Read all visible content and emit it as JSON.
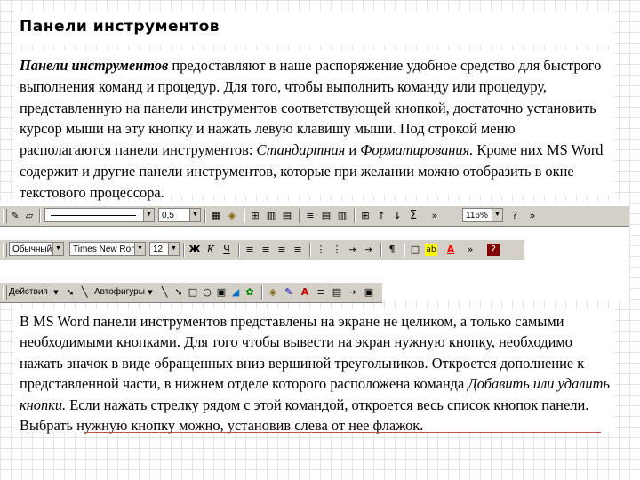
{
  "title": "Панели инструментов",
  "para1": {
    "lead_term": "Панели инструментов",
    "text_a": " предоставляют в наше распоряжение удобное средство для быстрого выполнения команд и процедур. Для того, чтобы выполнить команду или процедуру, представленную на панели инструментов соответствующей кнопкой, достаточно установить курсор мыши на эту кнопку и нажать левую клавишу мыши. Под строкой меню располагаются панели инструментов: ",
    "term_std": "Стандартная",
    "and": " и ",
    "term_fmt": "Форматирования.",
    "text_b": " Кроме них MS Word содержит и другие панели инструментов, которые при желании можно отобразить в окне текстового процессора."
  },
  "toolbars": {
    "standard": {
      "line_weight": "0,5",
      "zoom": "116%"
    },
    "formatting": {
      "style": "Обычный",
      "font": "Times New Roman",
      "size": "12",
      "bold": "Ж",
      "italic": "К",
      "underline": "Ч",
      "paragraph": "¶"
    },
    "drawing": {
      "draw_menu": "Действия",
      "autoshapes": "Автофигуры"
    }
  },
  "para2": {
    "text_a": "В MS Word панели инструментов представлены на экране не целиком, а только самыми необходимыми кнопками. Для того чтобы вывести на экран нужную кнопку, необходимо нажать значок в виде обращенных вниз вершиной треугольников. Откроется дополнение к представленной части, в нижнем отделе которого расположена команда ",
    "term_add": "Добавить или удалить кнопки.",
    "text_b": " Если нажать стрелку рядом с этой командой, откроется весь список кнопок панели. Выбрать нужную кнопку можно, установив слева от нее флажок."
  },
  "icons": {
    "pencil": "✎",
    "eraser": "▱",
    "borders": "▦",
    "fill": "◈",
    "table": "⊞",
    "insert-table": "▥",
    "columns": "▤",
    "sort-asc": "↑",
    "sort-desc": "↓",
    "sum": "Σ",
    "more": "»",
    "align-left": "≡",
    "list-num": "⋮",
    "indent": "⇥",
    "highlight": "ab",
    "font-color": "A",
    "arrow": "➘",
    "line": "╲",
    "rect": "□",
    "oval": "○",
    "textbox": "▣",
    "wordart": "◢",
    "clipart": "✿",
    "help": "?"
  },
  "colors": {
    "toolbar_bg": "#d4d0c8",
    "accent_line": "#c0504d",
    "highlight_yellow": "#ffff00",
    "font_red": "#ff0000"
  }
}
